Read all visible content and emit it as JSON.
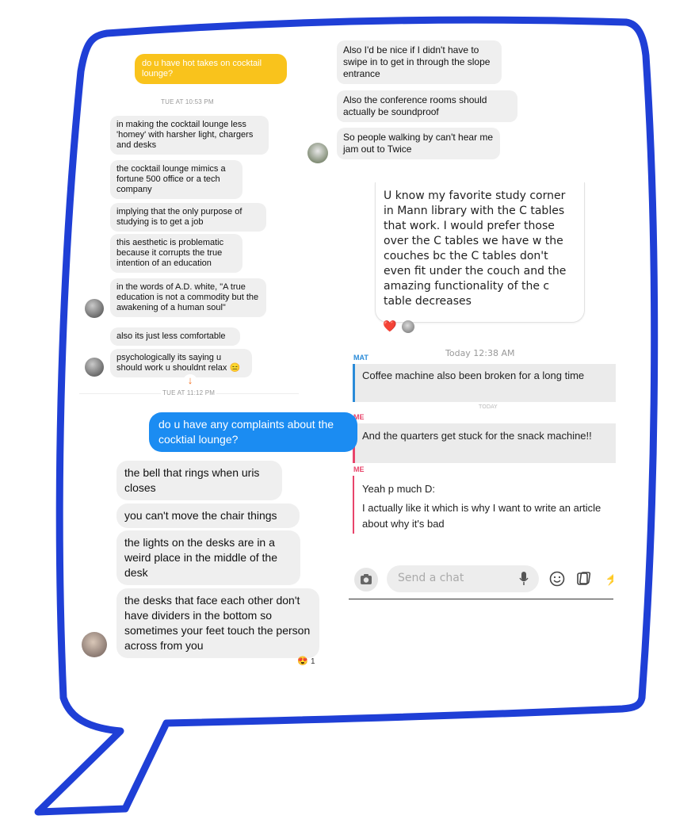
{
  "panel_a": {
    "outgoing_question": "do u have hot takes on cocktail lounge?",
    "timestamp1": "TUE AT 10:53 PM",
    "replies": [
      "in making the cocktail lounge less 'homey' with harsher light, chargers and desks",
      "the cocktail lounge mimics a fortune 500 office or a tech company",
      "implying that the only purpose of studying is to get a job",
      "this aesthetic is problematic because it corrupts the true intention of an education",
      "in the words of A.D. white, \"A true education is not a commodity but the awakening of a human soul\"",
      "also its just less comfortable",
      "psychologically its saying u should work u shouldnt relax 😑"
    ],
    "timestamp2": "TUE AT 11:12 PM"
  },
  "panel_b": {
    "messages": [
      "Also I'd be nice if I didn't have to swipe in to get in through the slope entrance",
      "Also the conference rooms should actually be soundproof",
      "So people walking by can't hear me jam out to Twice"
    ]
  },
  "panel_c": {
    "message": "U know my favorite study corner in Mann library with the C tables that work. I would prefer those over the C tables we have w the couches bc the C tables don't even fit under the couch and the amazing functionality of the c table decreases",
    "reaction": "❤️"
  },
  "panel_d": {
    "timestamp": "Today 12:38 AM",
    "rows": [
      {
        "name": "MAT",
        "name_color": "#2a8bd8",
        "messages": [
          "Coffee machine also been broken for a long time"
        ]
      },
      {
        "name": "ME",
        "name_color": "#e8456b",
        "messages": [
          "And the quarters get stuck for the snack machine!!"
        ]
      },
      {
        "name": "ME",
        "name_color": "#e8456b",
        "messages": [
          "Yeah p much D:",
          "I actually like it which is why I want to write an article about why it's bad"
        ]
      }
    ],
    "today_label": "TODAY",
    "input_placeholder": "Send a chat",
    "icons": [
      "camera-icon",
      "microphone-icon",
      "emoji-icon",
      "sticker-icon",
      "bitmoji-icon"
    ]
  },
  "panel_e": {
    "outgoing_question": "do u have any complaints about the cocktial lounge?",
    "replies": [
      "the bell that rings when uris closes",
      "you can't move the chair things",
      "the lights on the desks are in a weird place in the middle of the desk",
      "the desks that face each other don't have dividers in the bottom so sometimes your feet touch the person across from you"
    ],
    "reaction": "😍",
    "reaction_count": "1"
  },
  "colors": {
    "outline_blue": "#1f3fd6",
    "snap_yellow": "#f9c31c",
    "messenger_blue": "#1b8cf2",
    "bubble_gray": "#efefef",
    "mat_blue": "#2a8bd8",
    "me_red": "#e8456b"
  }
}
